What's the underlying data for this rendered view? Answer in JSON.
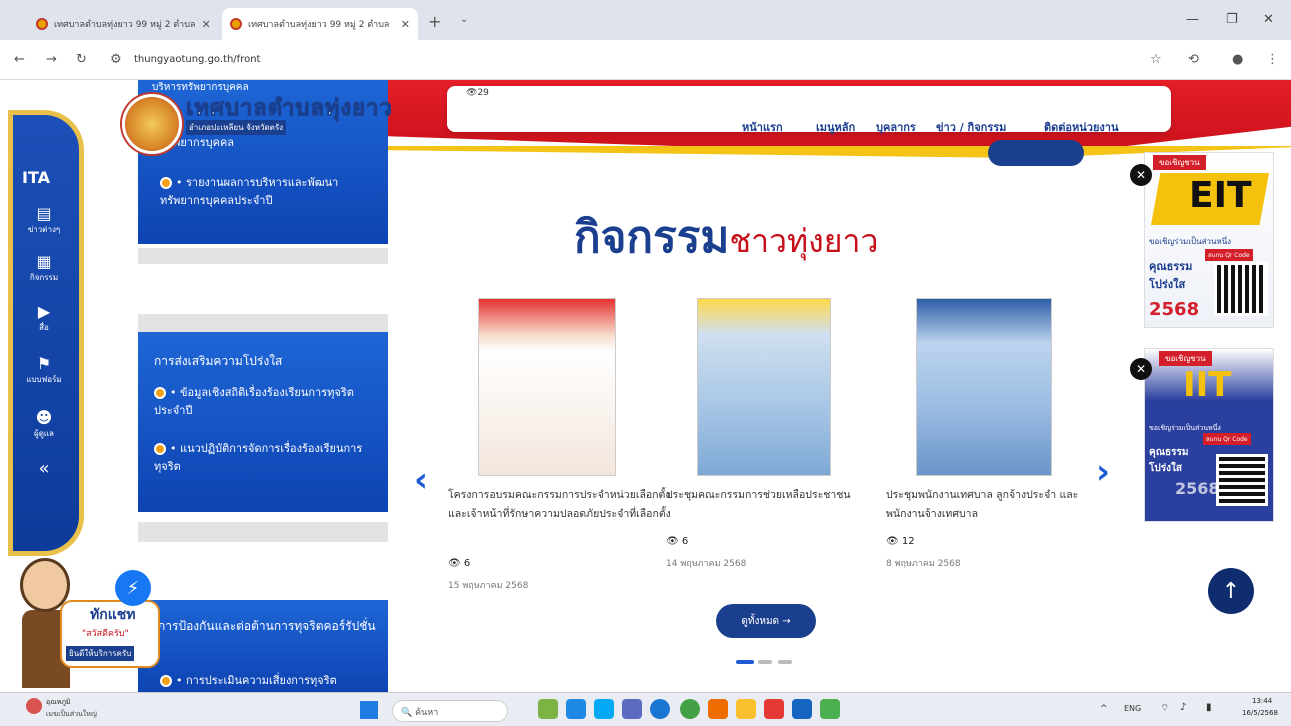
{
  "browser": {
    "tabs": [
      {
        "title": "เทศบาลตำบลทุ่งยาว 99 หมู่ 2 ตำบล",
        "active": false
      },
      {
        "title": "เทศบาลตำบลทุ่งยาว 99 หมู่ 2 ตำบล",
        "active": true
      }
    ],
    "new_tab": "+",
    "url": "thungyaotung.go.th/front"
  },
  "site": {
    "logo_title": "เทศบาลตำบลทุ่งยาว",
    "logo_sub": "อำเภอปะเหลียน จังหวัดตรัง",
    "view_count": "29",
    "nav": [
      "หน้าแรก",
      "เมนูหลัก",
      "บุคลากร",
      "ข่าว / กิจกรรม",
      "ติดต่อหน่วยงาน"
    ]
  },
  "rail": {
    "ita": "ITA",
    "items": [
      {
        "icon": "database-icon",
        "label": "ข่าวต่างๆ"
      },
      {
        "icon": "calendar-icon",
        "label": "กิจกรรม"
      },
      {
        "icon": "play-icon",
        "label": "สื่อ"
      },
      {
        "icon": "flag-icon",
        "label": "แบบฟอร์ม"
      },
      {
        "icon": "user-icon",
        "label": "ผู้ดูแล"
      }
    ],
    "collapse": "«"
  },
  "left_cards": {
    "card1": {
      "top_text": "บริหารทรัพยากรบุคคล",
      "partial_text": "หรัพยากรบุคคล",
      "item": "• รายงานผลการบริหารและพัฒนาทรัพยากรบุคคลประจำปี"
    },
    "card2": {
      "title": "การส่งเสริมความโปร่งใส",
      "items": [
        "• ข้อมูลเชิงสถิติเรื่องร้องเรียนการทุจริตประจำปี",
        "• แนวปฏิบัติการจัดการเรื่องร้องเรียนการทุจริต"
      ]
    },
    "card3": {
      "title": "การป้องกันและต่อต้านการทุจริตคอร์รัปชั่น",
      "item": "• การประเมินความเสี่ยงการทุจริต"
    }
  },
  "heading": {
    "main": "กิจกรรม",
    "sub": "ชาวทุ่งยาว"
  },
  "activities": [
    {
      "title": "โครงการอบรมคณะกรรมการประจำหน่วยเลือกตั้งและเจ้าหน้าที่รักษาความปลอดภัยประจำที่เลือกตั้ง",
      "views": "6",
      "date": "15 พฤษภาคม 2568"
    },
    {
      "title": "ประชุมคณะกรรมการช่วยเหลือประชาชน",
      "views": "6",
      "date": "14 พฤษภาคม 2568"
    },
    {
      "title": "ประชุมพนักงานเทศบาล ลูกจ้างประจำ และพนักงานจ้างเทศบาล",
      "views": "12",
      "date": "8 พฤษภาคม 2568"
    }
  ],
  "more_button": "ดูทั้งหมด →",
  "badges": {
    "eit": {
      "tag": "ขอเชิญชวน",
      "big": "EIT",
      "line1": "ขอเชิญร่วมเป็นส่วนหนึ่ง",
      "line2": "คุณธรรม",
      "line3": "โปร่งใส",
      "year": "2568",
      "qr": "สแกน Qr Code"
    },
    "iit": {
      "tag": "ขอเชิญชวน",
      "big": "IIT",
      "line1": "ขอเชิญร่วมเป็นส่วนหนึ่ง",
      "line2": "คุณธรรม",
      "line3": "โปร่งใส",
      "year": "2568",
      "qr": "สแกน Qr Code"
    }
  },
  "mascot": {
    "greet": "ทักแชท",
    "hello": "\"สวัสดีครับ\"",
    "offer": "ยินดีให้บริการครับ"
  },
  "taskbar": {
    "weather_temp": "อุณหภูมิ",
    "weather_desc": "เมฆเป็นส่วนใหญ่",
    "search": "ค้นหา",
    "lang": "ENG",
    "time": "13:44",
    "date": "16/5/2568"
  }
}
